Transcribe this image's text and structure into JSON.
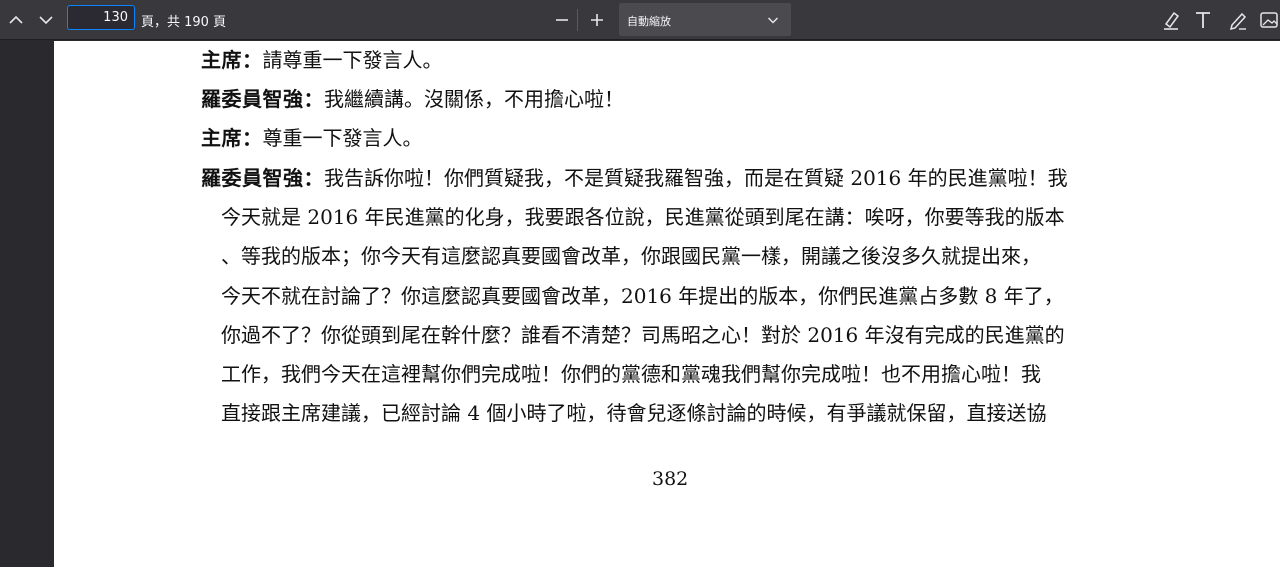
{
  "toolbar": {
    "page_value": "130",
    "page_count": "頁，共 190 頁",
    "zoom_value": "自動縮放"
  },
  "document": {
    "paragraphs": [
      {
        "speaker": "主席：",
        "text": "請尊重一下發言人。"
      },
      {
        "speaker": "羅委員智強：",
        "text": "我繼續講。沒關係，不用擔心啦！"
      },
      {
        "speaker": "主席：",
        "text": "尊重一下發言人。"
      },
      {
        "speaker": "羅委員智強：",
        "text": "我告訴你啦！你們質疑我，不是質疑我羅智強，而是在質疑 2016 年的民進黨啦！我"
      }
    ],
    "continuation_lines": [
      "今天就是 2016 年民進黨的化身，我要跟各位說，民進黨從頭到尾在講：唉呀，你要等我的版本",
      "、等我的版本；你今天有這麼認真要國會改革，你跟國民黨一樣，開議之後沒多久就提出來，",
      "今天不就在討論了？你這麼認真要國會改革，2016 年提出的版本，你們民進黨占多數 8 年了，",
      "你過不了？你從頭到尾在幹什麼？誰看不清楚？司馬昭之心！對於 2016 年沒有完成的民進黨的",
      "工作，我們今天在這裡幫你們完成啦！你們的黨德和黨魂我們幫你完成啦！也不用擔心啦！我",
      "直接跟主席建議，已經討論 4 個小時了啦，待會兒逐條討論的時候，有爭議就保留，直接送協"
    ],
    "page_number": "382"
  }
}
